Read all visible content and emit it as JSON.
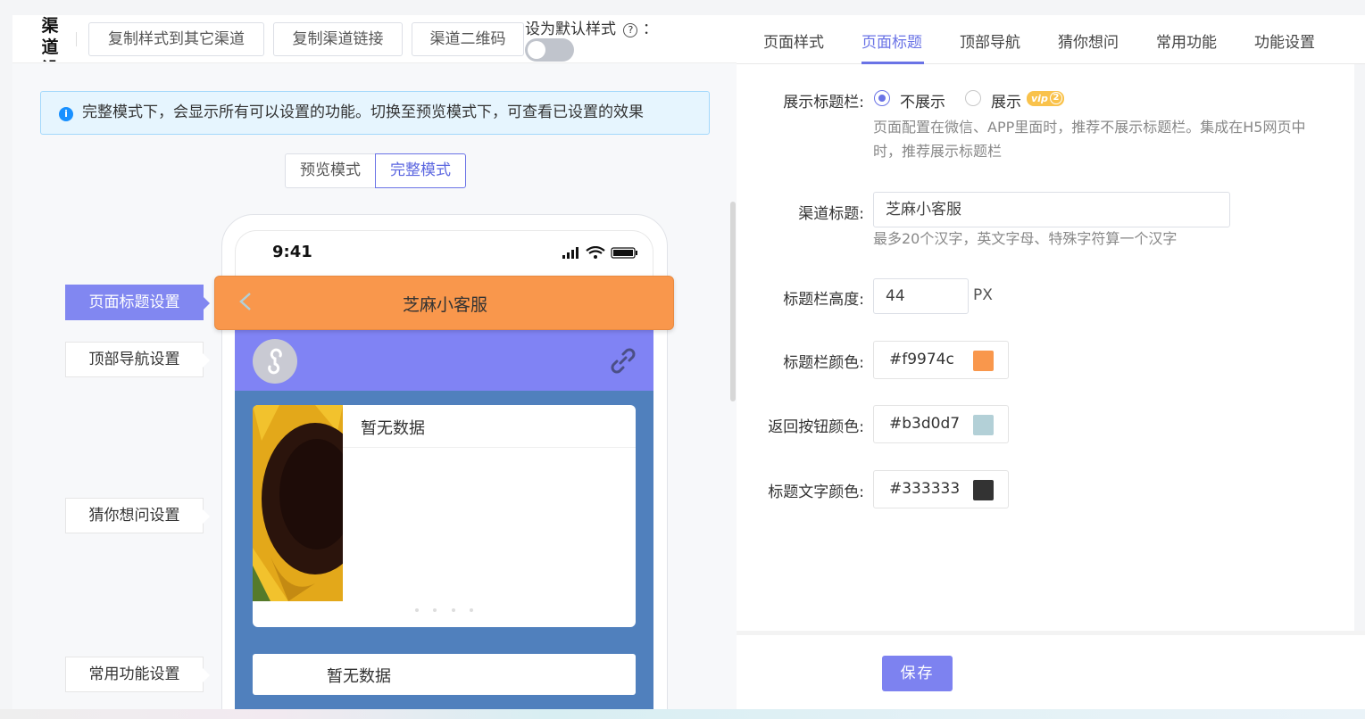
{
  "sidebar_title_chars": [
    "渠",
    "道",
    "设"
  ],
  "toolbar": {
    "copy_style_label": "复制样式到其它渠道",
    "copy_link_label": "复制渠道链接",
    "qr_label": "渠道二维码",
    "default_style_label": "设为默认样式",
    "default_style_colon": "：",
    "default_style_on": false
  },
  "info": {
    "text": "完整模式下，会显示所有可以设置的功能。切换至预览模式下，可查看已设置的效果"
  },
  "mode": {
    "preview_label": "预览模式",
    "full_label": "完整模式",
    "selected": "完整模式"
  },
  "phone": {
    "time": "9:41",
    "page_title": "芝麻小客服",
    "card1_empty": "暂无数据",
    "card2_empty": "暂无数据"
  },
  "side_labels": {
    "page_title": "页面标题设置",
    "top_nav": "顶部导航设置",
    "guess": "猜你想问设置",
    "common": "常用功能设置"
  },
  "tabs": [
    "页面样式",
    "页面标题",
    "顶部导航",
    "猜你想问",
    "常用功能",
    "功能设置"
  ],
  "active_tab": "页面标题",
  "form": {
    "show_title_label": "展示标题栏:",
    "opt_hide": "不展示",
    "opt_show": "展示",
    "vip_badge": "vip",
    "vip_level": "2",
    "selected_option": "不展示",
    "show_title_hint_line1": "页面配置在微信、APP里面时，推荐不展示标题栏。集成在H5网页中",
    "show_title_hint_line2": "时，推荐展示标题栏",
    "channel_title_label": "渠道标题:",
    "channel_title_value": "芝麻小客服",
    "channel_title_hint": "最多20个汉字，英文字母、特殊字符算一个汉字",
    "height_label": "标题栏高度:",
    "height_value": "44",
    "height_unit": "PX",
    "bar_color_label": "标题栏颜色:",
    "bar_color_value": "#f9974c",
    "back_color_label": "返回按钮颜色:",
    "back_color_value": "#b3d0d7",
    "text_color_label": "标题文字颜色:",
    "text_color_value": "#333333"
  },
  "save_label": "保存"
}
